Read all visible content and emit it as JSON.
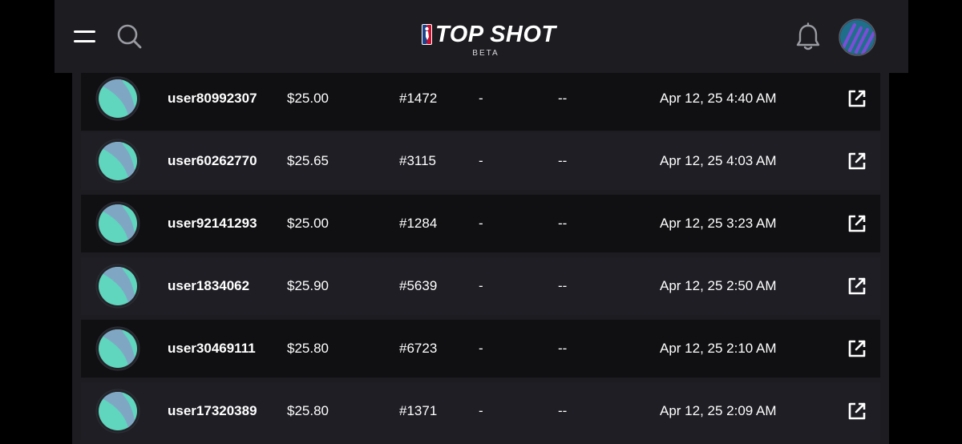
{
  "header": {
    "logo_text": "TOP SHOT",
    "logo_subtitle": "BETA",
    "icons": {
      "menu": "menu-icon",
      "search": "search-icon",
      "notifications": "bell-icon",
      "profile": "avatar"
    },
    "colors": {
      "header_bg": "#1c1c21",
      "nba_blue": "#1d428a",
      "nba_red": "#c8102e",
      "avatar_bg": "#1f6f8b",
      "avatar_stripes": "#7c4dd8"
    }
  },
  "table": {
    "rows": [
      {
        "username": "user80992307",
        "price": "$25.00",
        "serial": "#1472",
        "col4": "-",
        "col5": "--",
        "date": "Apr 12, 25 4:40 AM"
      },
      {
        "username": "user60262770",
        "price": "$25.65",
        "serial": "#3115",
        "col4": "-",
        "col5": "--",
        "date": "Apr 12, 25 4:03 AM"
      },
      {
        "username": "user92141293",
        "price": "$25.00",
        "serial": "#1284",
        "col4": "-",
        "col5": "--",
        "date": "Apr 12, 25 3:23 AM"
      },
      {
        "username": "user1834062",
        "price": "$25.90",
        "serial": "#5639",
        "col4": "-",
        "col5": "--",
        "date": "Apr 12, 25 2:50 AM"
      },
      {
        "username": "user30469111",
        "price": "$25.80",
        "serial": "#6723",
        "col4": "-",
        "col5": "--",
        "date": "Apr 12, 25 2:10 AM"
      },
      {
        "username": "user17320389",
        "price": "$25.80",
        "serial": "#1371",
        "col4": "-",
        "col5": "--",
        "date": "Apr 12, 25 2:09 AM"
      }
    ],
    "row_icon": "external-link-icon",
    "colors": {
      "row_dark": "#101013",
      "row_light": "#1e1e24",
      "avatar_teal": "#5fd6bd",
      "avatar_blue": "#7fa7c4",
      "avatar_yellow": "#f2e53a"
    }
  }
}
